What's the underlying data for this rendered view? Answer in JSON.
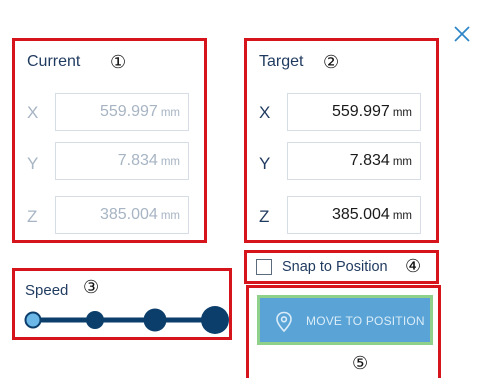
{
  "dialog": {
    "close_icon": "close-icon"
  },
  "current": {
    "title": "Current",
    "callout": "①",
    "rows": [
      {
        "axis": "X",
        "value": "559.997",
        "unit": "mm"
      },
      {
        "axis": "Y",
        "value": "7.834",
        "unit": "mm"
      },
      {
        "axis": "Z",
        "value": "385.004",
        "unit": "mm"
      }
    ]
  },
  "target": {
    "title": "Target",
    "callout": "②",
    "rows": [
      {
        "axis": "X",
        "value": "559.997",
        "unit": "mm"
      },
      {
        "axis": "Y",
        "value": "7.834",
        "unit": "mm"
      },
      {
        "axis": "Z",
        "value": "385.004",
        "unit": "mm"
      }
    ]
  },
  "speed": {
    "label": "Speed",
    "callout": "③",
    "levels": 4,
    "selected_level": 1
  },
  "snap": {
    "label": "Snap to Position",
    "callout": "④",
    "checked": false
  },
  "move": {
    "label": "MOVE TO POSITION",
    "callout": "⑤",
    "icon": "location-pin-icon"
  },
  "colors": {
    "highlight_box": "#d6141b",
    "text_dark": "#1f3a5f",
    "text_dim": "#a7b4c3",
    "slider_dark": "#0b3e6b",
    "slider_selected": "#6ab7e8",
    "button_fill": "#5aa3d6",
    "button_border": "#8fd08a"
  }
}
